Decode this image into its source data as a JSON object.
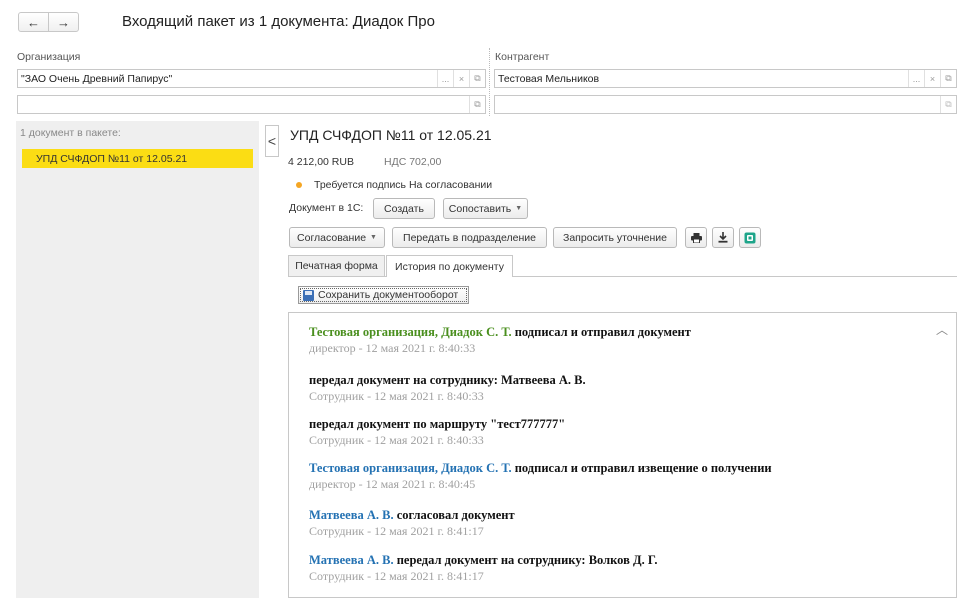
{
  "nav": {
    "back": "←",
    "forward": "→"
  },
  "title": "Входящий пакет из 1 документа: Диадок Про",
  "organization": {
    "label": "Организация",
    "value": "\"ЗАО Очень Древний Папирус\"",
    "value2": ""
  },
  "counterparty": {
    "label": "Контрагент",
    "value": "Тестовая Мельников",
    "value2": ""
  },
  "field_buttons": {
    "ellipsis": "...",
    "clear": "×",
    "open": "⧉"
  },
  "left_panel": {
    "caption": "1 документ в пакете:",
    "items": [
      "УПД СЧФДОП №11 от 12.05.21"
    ]
  },
  "collapse_icon": "<",
  "document": {
    "title": "УПД СЧФДОП №11 от 12.05.21",
    "amount": "4 212,00  RUB",
    "vat": "НДС 702,00",
    "status_color": "#f5a623",
    "status": "Требуется подпись   На согласовании",
    "doc_in_1c_label": "Документ в 1С:",
    "create_label": "Создать",
    "match_label": "Сопоставить"
  },
  "toolbar": {
    "approval_label": "Согласование",
    "transfer_label": "Передать в подразделение",
    "clarify_label": "Запросить уточнение",
    "print_icon": "printer-icon",
    "download_icon": "download-icon",
    "extra_icon": "app-icon"
  },
  "tabs": [
    {
      "label": "Печатная форма",
      "active": false
    },
    {
      "label": "История по документу",
      "active": true
    }
  ],
  "save_flow_label": "Сохранить документооборот",
  "history": [
    {
      "actor": "Тестовая организация, Диадок С. Т.",
      "actor_color": "green",
      "action": " подписал и отправил документ",
      "meta": "директор - 12 мая 2021 г. 8:40:33"
    },
    {
      "actor": "",
      "actor_color": "",
      "action": "передал документ на сотруднику: Матвеева А. В.",
      "meta": "Сотрудник - 12 мая 2021 г. 8:40:33"
    },
    {
      "actor": "",
      "actor_color": "",
      "action": "передал документ по маршруту \"тест777777\"",
      "meta": "Сотрудник - 12 мая 2021 г. 8:40:33"
    },
    {
      "actor": "Тестовая организация, Диадок С. Т.",
      "actor_color": "blue",
      "action": " подписал и отправил извещение о получении",
      "meta": "директор - 12 мая 2021 г. 8:40:45"
    },
    {
      "actor": "Матвеева А. В.",
      "actor_color": "blue",
      "action": " согласовал документ",
      "meta": "Сотрудник - 12 мая 2021 г. 8:41:17"
    },
    {
      "actor": "Матвеева А. В.",
      "actor_color": "blue",
      "action": " передал документ на сотруднику: Волков Д. Г.",
      "meta": "Сотрудник - 12 мая 2021 г. 8:41:17"
    }
  ]
}
